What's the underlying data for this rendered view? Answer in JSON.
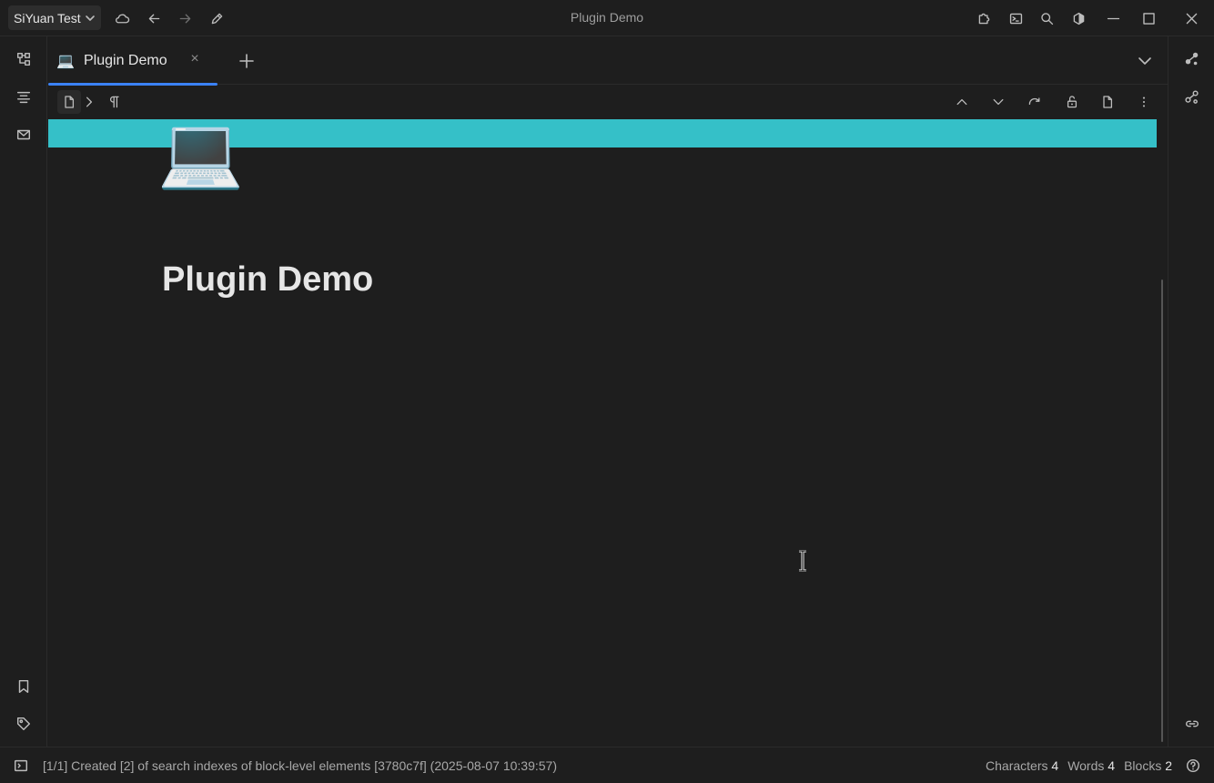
{
  "window": {
    "title": "Plugin Demo"
  },
  "workspace": {
    "name": "SiYuan Test"
  },
  "tab": {
    "icon": "💻",
    "label": "Plugin Demo",
    "close": "×"
  },
  "document": {
    "icon": "💻",
    "title": "Plugin Demo",
    "banner_color": "#35c0c8"
  },
  "status": {
    "message": "[1/1] Created [2] of search indexes of block-level elements [3780c7f] (2025-08-07 10:39:57)",
    "characters_label": "Characters",
    "characters": "4",
    "words_label": "Words",
    "words": "4",
    "blocks_label": "Blocks",
    "blocks": "2"
  },
  "accent_color": "#3b82f6"
}
